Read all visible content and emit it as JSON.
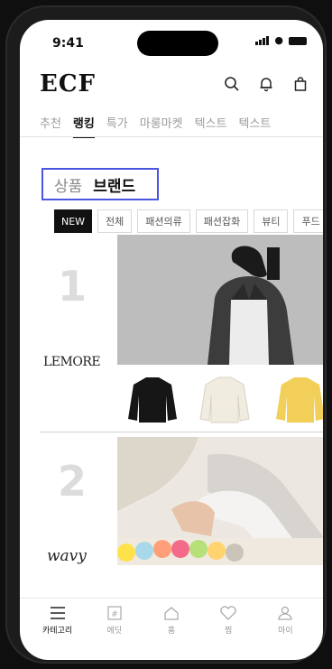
{
  "status": {
    "time": "9:41"
  },
  "header": {
    "logo": "ECF"
  },
  "category_tabs": [
    "추천",
    "랭킹",
    "특가",
    "마롱마켓",
    "텍스트",
    "텍스트"
  ],
  "active_tab_index": 1,
  "toggle": {
    "off_label": "상품",
    "on_label": "브랜드"
  },
  "chips": [
    "NEW",
    "전체",
    "패션의류",
    "패션잡화",
    "뷰티",
    "푸드"
  ],
  "rankings": [
    {
      "rank": "1",
      "brand": "LEMORE"
    },
    {
      "rank": "2",
      "brand": "wavy"
    }
  ],
  "bottom_nav": [
    {
      "label": "카테고리",
      "icon": "menu-icon"
    },
    {
      "label": "에딧",
      "icon": "edit-icon"
    },
    {
      "label": "홈",
      "icon": "home-icon"
    },
    {
      "label": "찜",
      "icon": "heart-icon"
    },
    {
      "label": "마이",
      "icon": "user-icon"
    }
  ],
  "colors": {
    "accent_border": "#4a55e0",
    "text": "#111111",
    "muted": "#9b9b9b"
  }
}
